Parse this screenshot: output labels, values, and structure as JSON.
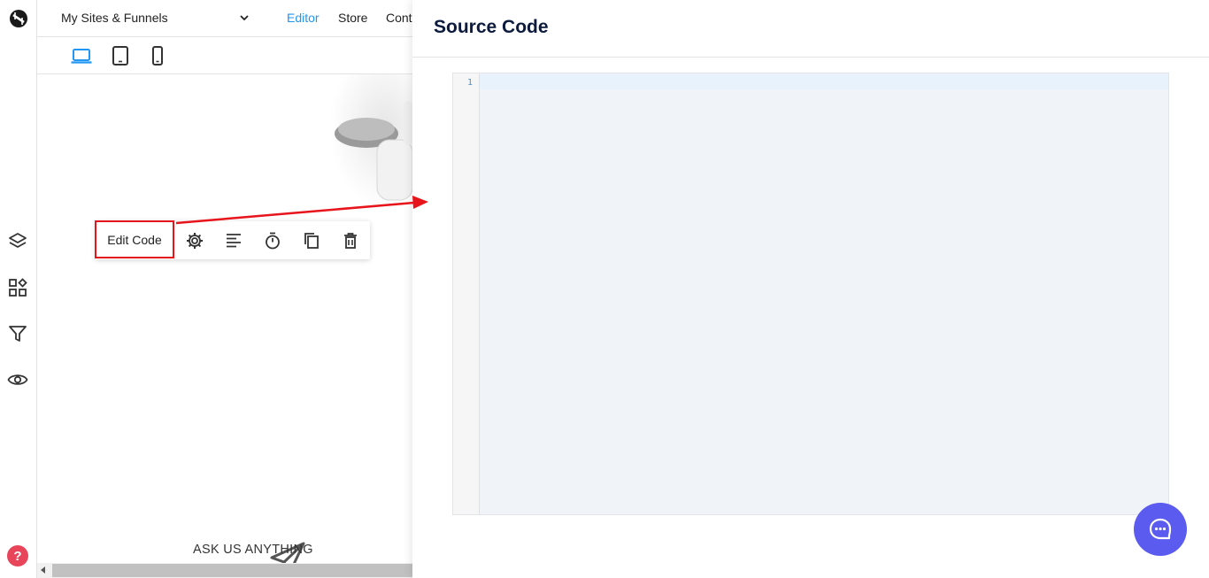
{
  "topbar": {
    "site_select": "My Sites & Funnels",
    "nav": [
      "Editor",
      "Store",
      "Cont"
    ]
  },
  "toolbar": {
    "edit_code_label": "Edit Code"
  },
  "canvas": {
    "ask_label": "ASK US ANYTHING"
  },
  "panel": {
    "title": "Source Code",
    "line_number": "1",
    "code": ""
  },
  "colors": {
    "accent": "#2196f3",
    "annotation": "#e8141b",
    "chat": "#5b5bf0",
    "help": "#e8445a"
  }
}
